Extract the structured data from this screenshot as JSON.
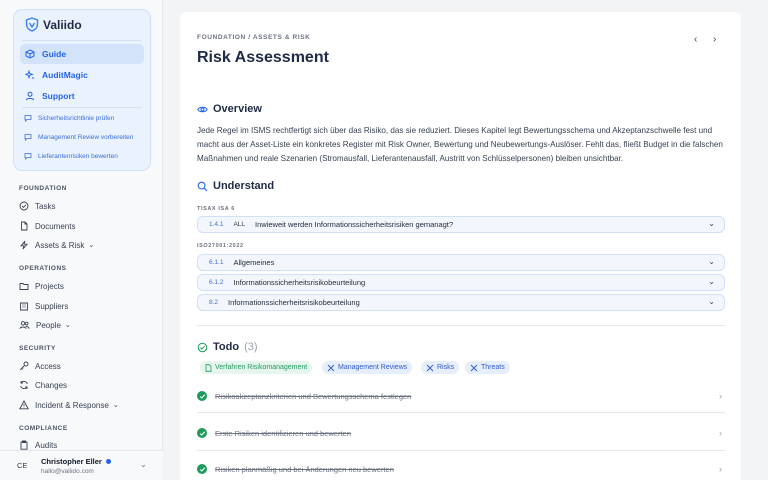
{
  "app": {
    "name": "Valiido"
  },
  "ai_panel": {
    "items": [
      {
        "label": "Guide",
        "icon": "cube-icon",
        "active": true
      },
      {
        "label": "AuditMagic",
        "icon": "sparkle-icon",
        "active": false
      },
      {
        "label": "Support",
        "icon": "user-icon",
        "active": false
      }
    ],
    "prompts": [
      "Sicherheitsrichtlinie prüfen",
      "Management Review vorbereiten",
      "Lieferantenrisiken bewerten"
    ]
  },
  "nav": {
    "foundation": {
      "title": "FOUNDATION",
      "items": [
        {
          "label": "Tasks",
          "icon": "check-circle-icon"
        },
        {
          "label": "Documents",
          "icon": "document-icon"
        },
        {
          "label": "Assets & Risk",
          "icon": "bolt-icon",
          "expandable": true
        }
      ]
    },
    "operations": {
      "title": "OPERATIONS",
      "items": [
        {
          "label": "Projects",
          "icon": "folder-icon"
        },
        {
          "label": "Suppliers",
          "icon": "building-icon"
        },
        {
          "label": "People",
          "icon": "people-icon",
          "expandable": true
        }
      ]
    },
    "security": {
      "title": "SECURITY",
      "items": [
        {
          "label": "Access",
          "icon": "key-icon"
        },
        {
          "label": "Changes",
          "icon": "refresh-icon"
        },
        {
          "label": "Incident & Response",
          "icon": "warning-icon",
          "expandable": true
        }
      ]
    },
    "compliance": {
      "title": "COMPLIANCE",
      "items": [
        {
          "label": "Audits",
          "icon": "clipboard-icon"
        }
      ]
    }
  },
  "user": {
    "initials": "CE",
    "name": "Christopher Eller",
    "email": "hallo@valiido.com"
  },
  "page": {
    "breadcrumb": "FOUNDATION / ASSETS & RISK",
    "title": "Risk Assessment",
    "prev": "‹",
    "next": "›"
  },
  "overview": {
    "heading": "Overview",
    "text": "Jede Regel im ISMS rechtfertigt sich über das Risiko, das sie reduziert. Dieses Kapitel legt Bewertungsschema und Akzeptanzschwelle fest und macht aus der Asset-Liste ein konkretes Register mit Risk Owner, Bewertung und Neubewertungs-Auslöser. Fehlt das, fließt Budget in die falschen Maßnahmen und reale Szenarien (Stromausfall, Lieferantenausfall, Austritt von Schlüsselpersonen) bleiben unsichtbar."
  },
  "understand": {
    "heading": "Understand",
    "tisax_label": "TISAX ISA 6",
    "tisax": [
      {
        "code": "1.4.1",
        "scope": "ALL",
        "text": "Inwieweit werden Informationssicherheitsrisiken gemanagt?"
      }
    ],
    "iso_label": "ISO27001:2022",
    "iso": [
      {
        "code": "6.1.1",
        "text": "Allgemeines"
      },
      {
        "code": "6.1.2",
        "text": "Informationssicherheitsrisikobeurteilung"
      },
      {
        "code": "8.2",
        "text": "Informationssicherheitsrisikobeurteilung"
      }
    ]
  },
  "todo": {
    "heading": "Todo",
    "count": "(3)",
    "tags": [
      {
        "label": "Verfahren Risikomanagement",
        "color": "#1e9a5c"
      },
      {
        "label": "Management Reviews",
        "color": "#2b5cc9"
      },
      {
        "label": "Risks",
        "color": "#2b5cc9"
      },
      {
        "label": "Threats",
        "color": "#2b5cc9"
      }
    ],
    "items": [
      {
        "text": "Risikoakzeptanzkriterien und Bewertungsschema festlegen",
        "done": true
      },
      {
        "text": "Erste Risiken identifizieren und bewerten",
        "done": true
      },
      {
        "text": "Risiken planmäßig und bei Änderungen neu bewerten",
        "done": true
      }
    ]
  },
  "colors": {
    "accent": "#2563eb",
    "success": "#1e9a5c"
  }
}
